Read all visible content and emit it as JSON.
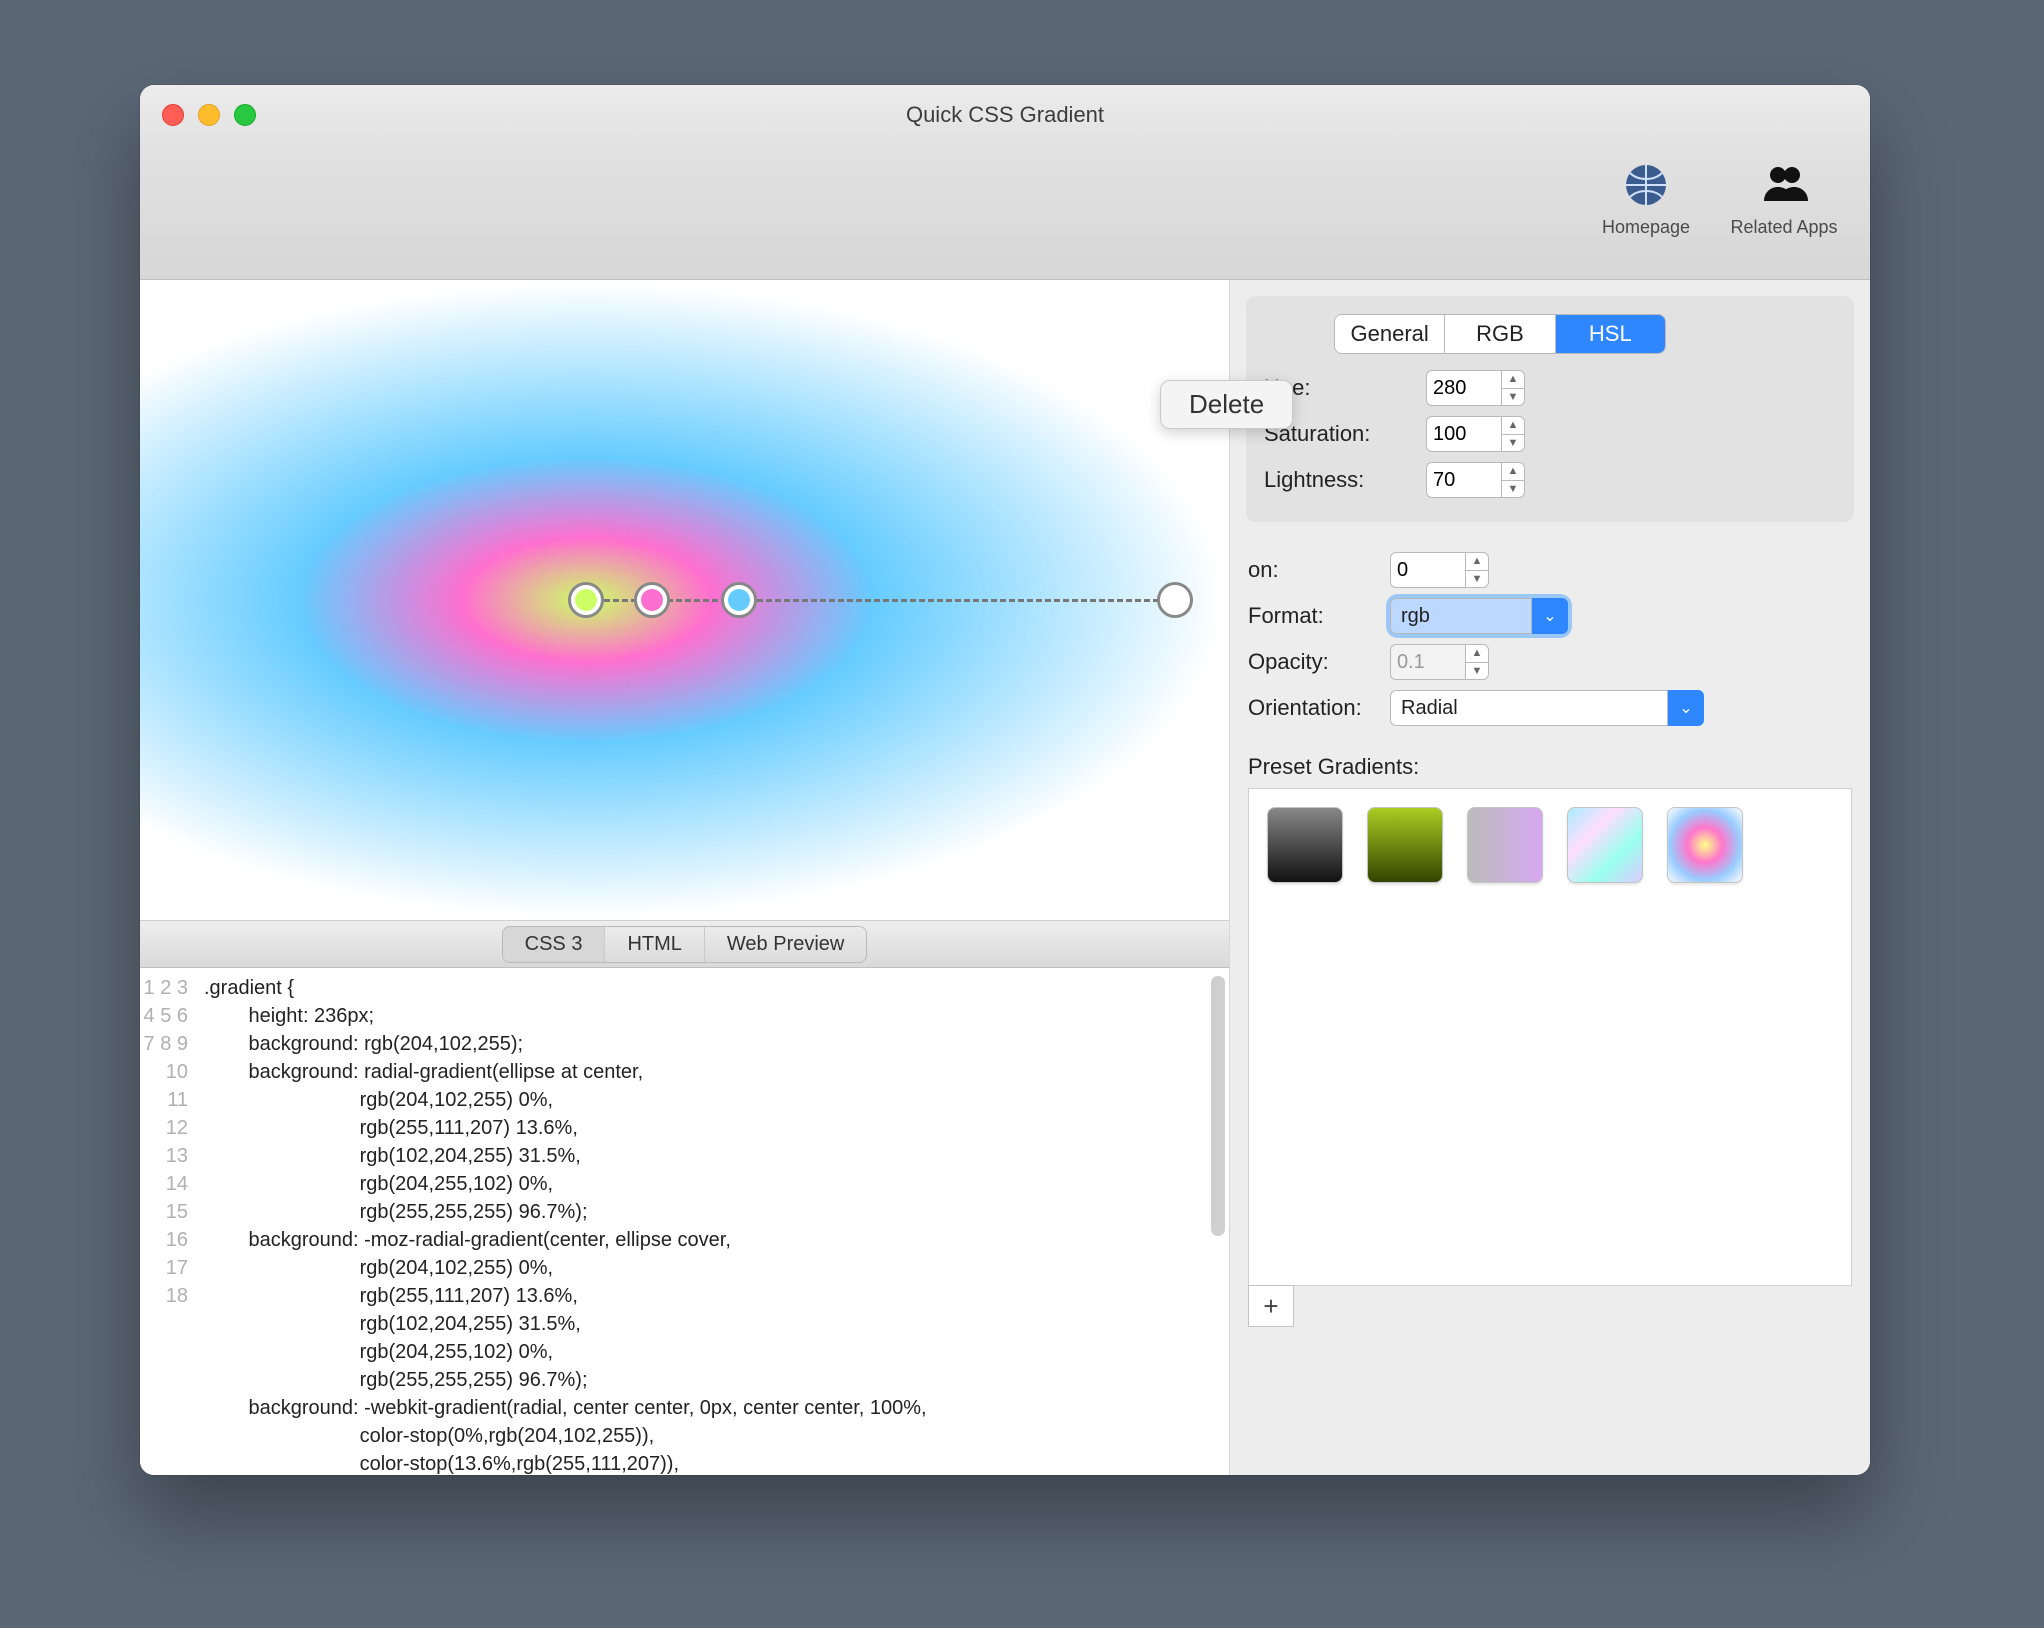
{
  "window": {
    "title": "Quick CSS Gradient"
  },
  "toolbar": {
    "homepage_label": "Homepage",
    "related_label": "Related Apps"
  },
  "preview": {
    "context_menu": {
      "delete": "Delete"
    },
    "stops": [
      {
        "pos_pct": 41,
        "color": "#ccff66"
      },
      {
        "pos_pct": 47,
        "color": "#ff6fcf"
      },
      {
        "pos_pct": 55,
        "color": "#66ccff"
      },
      {
        "pos_pct": 95,
        "color": "#ffffff"
      }
    ]
  },
  "code_tabs": {
    "css3": "CSS 3",
    "html": "HTML",
    "web": "Web Preview",
    "active": "css3"
  },
  "code": {
    "lines": [
      ".gradient {",
      "        height: 236px;",
      "        background: rgb(204,102,255);",
      "        background: radial-gradient(ellipse at center,",
      "                            rgb(204,102,255) 0%,",
      "                            rgb(255,111,207) 13.6%,",
      "                            rgb(102,204,255) 31.5%,",
      "                            rgb(204,255,102) 0%,",
      "                            rgb(255,255,255) 96.7%);",
      "        background: -moz-radial-gradient(center, ellipse cover,",
      "                            rgb(204,102,255) 0%,",
      "                            rgb(255,111,207) 13.6%,",
      "                            rgb(102,204,255) 31.5%,",
      "                            rgb(204,255,102) 0%,",
      "                            rgb(255,255,255) 96.7%);",
      "        background: -webkit-gradient(radial, center center, 0px, center center, 100%,",
      "                            color-stop(0%,rgb(204,102,255)),",
      "                            color-stop(13.6%,rgb(255,111,207)),"
    ]
  },
  "panel": {
    "tabs": {
      "general": "General",
      "rgb": "RGB",
      "hsl": "HSL",
      "active": "hsl"
    },
    "hsl": {
      "hue_label": "Hue:",
      "hue_value": "280",
      "sat_label": "Saturation:",
      "sat_value": "100",
      "lig_label": "Lightness:",
      "lig_value": "70"
    },
    "mid": {
      "position_label_suffix": "on:",
      "position_value": "0",
      "format_label": "Format:",
      "format_value": "rgb",
      "opacity_label": "Opacity:",
      "opacity_value": "0.1",
      "orientation_label": "Orientation:",
      "orientation_value": "Radial"
    },
    "presets_label": "Preset Gradients:",
    "add_label": "+"
  }
}
